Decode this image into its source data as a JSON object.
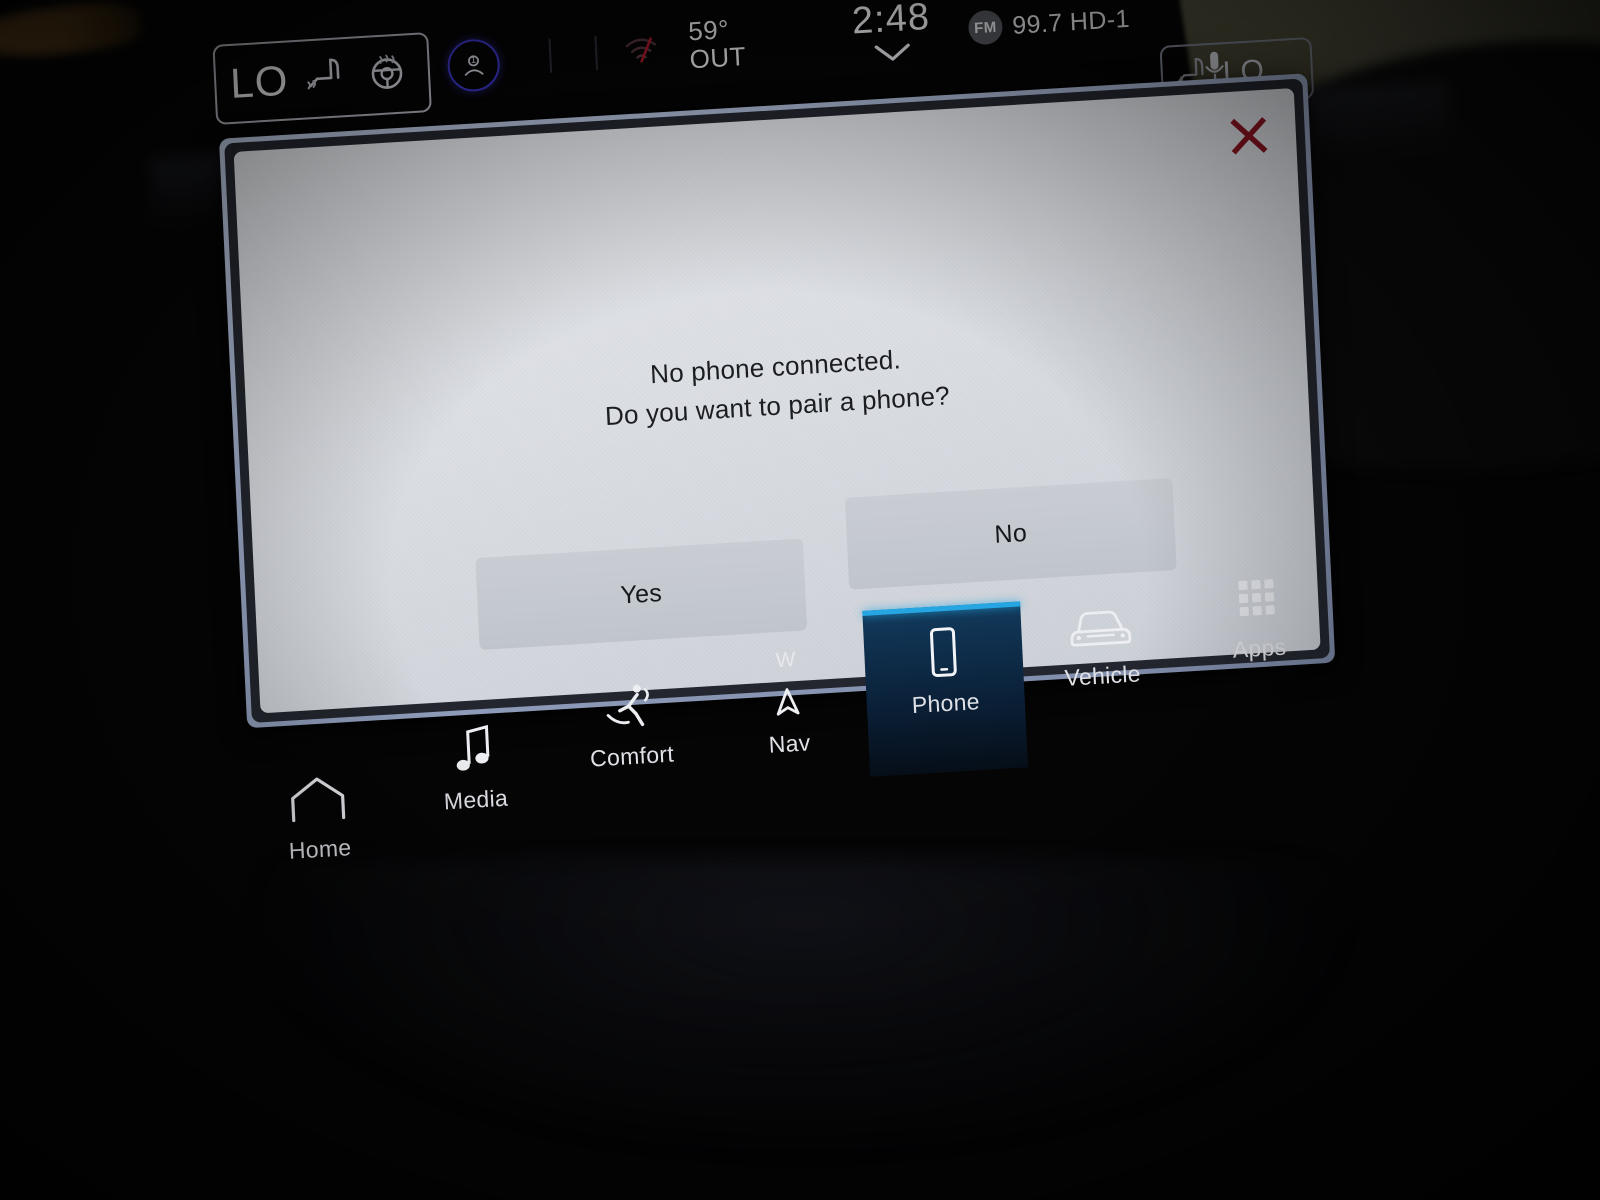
{
  "status_bar": {
    "climate_left": {
      "level_label": "LO",
      "icons": [
        "heated-seat-icon",
        "heated-steering-wheel-icon"
      ]
    },
    "driver_profile_icon": "driver-profile-icon",
    "wifi_icon": "wifi-off-icon",
    "outside_temperature": {
      "value": "59°",
      "label": "OUT"
    },
    "clock": {
      "time": "2:48",
      "expand_icon": "chevron-down-icon"
    },
    "radio": {
      "band_badge": "FM",
      "station": "99.7 HD-1"
    },
    "microphone_icon": "microphone-icon",
    "climate_right": {
      "level_label": "LO",
      "icons": [
        "heated-seat-icon"
      ]
    }
  },
  "dialog": {
    "close_icon": "close-x-icon",
    "message_line_1": "No phone connected.",
    "message_line_2": "Do you want to pair a phone?",
    "buttons": {
      "yes": "Yes",
      "no": "No"
    }
  },
  "nav_bar": {
    "active_item": "Phone",
    "compass_heading": "W",
    "items": [
      {
        "label": "Home",
        "icon": "home-icon"
      },
      {
        "label": "Media",
        "icon": "music-note-icon"
      },
      {
        "label": "Comfort",
        "icon": "seat-comfort-icon"
      },
      {
        "label": "Nav",
        "icon": "navigation-arrow-icon"
      },
      {
        "label": "Phone",
        "icon": "phone-icon"
      },
      {
        "label": "Vehicle",
        "icon": "car-front-icon"
      },
      {
        "label": "Apps",
        "icon": "apps-grid-icon"
      }
    ]
  },
  "colors": {
    "accent_blue": "#25a6e2",
    "close_red": "#8c1420",
    "profile_blue": "#3d37c8",
    "wifi_red": "#a4192b",
    "dialog_surface": "#dcdfe4",
    "button_gray": "#c4c9d0"
  }
}
